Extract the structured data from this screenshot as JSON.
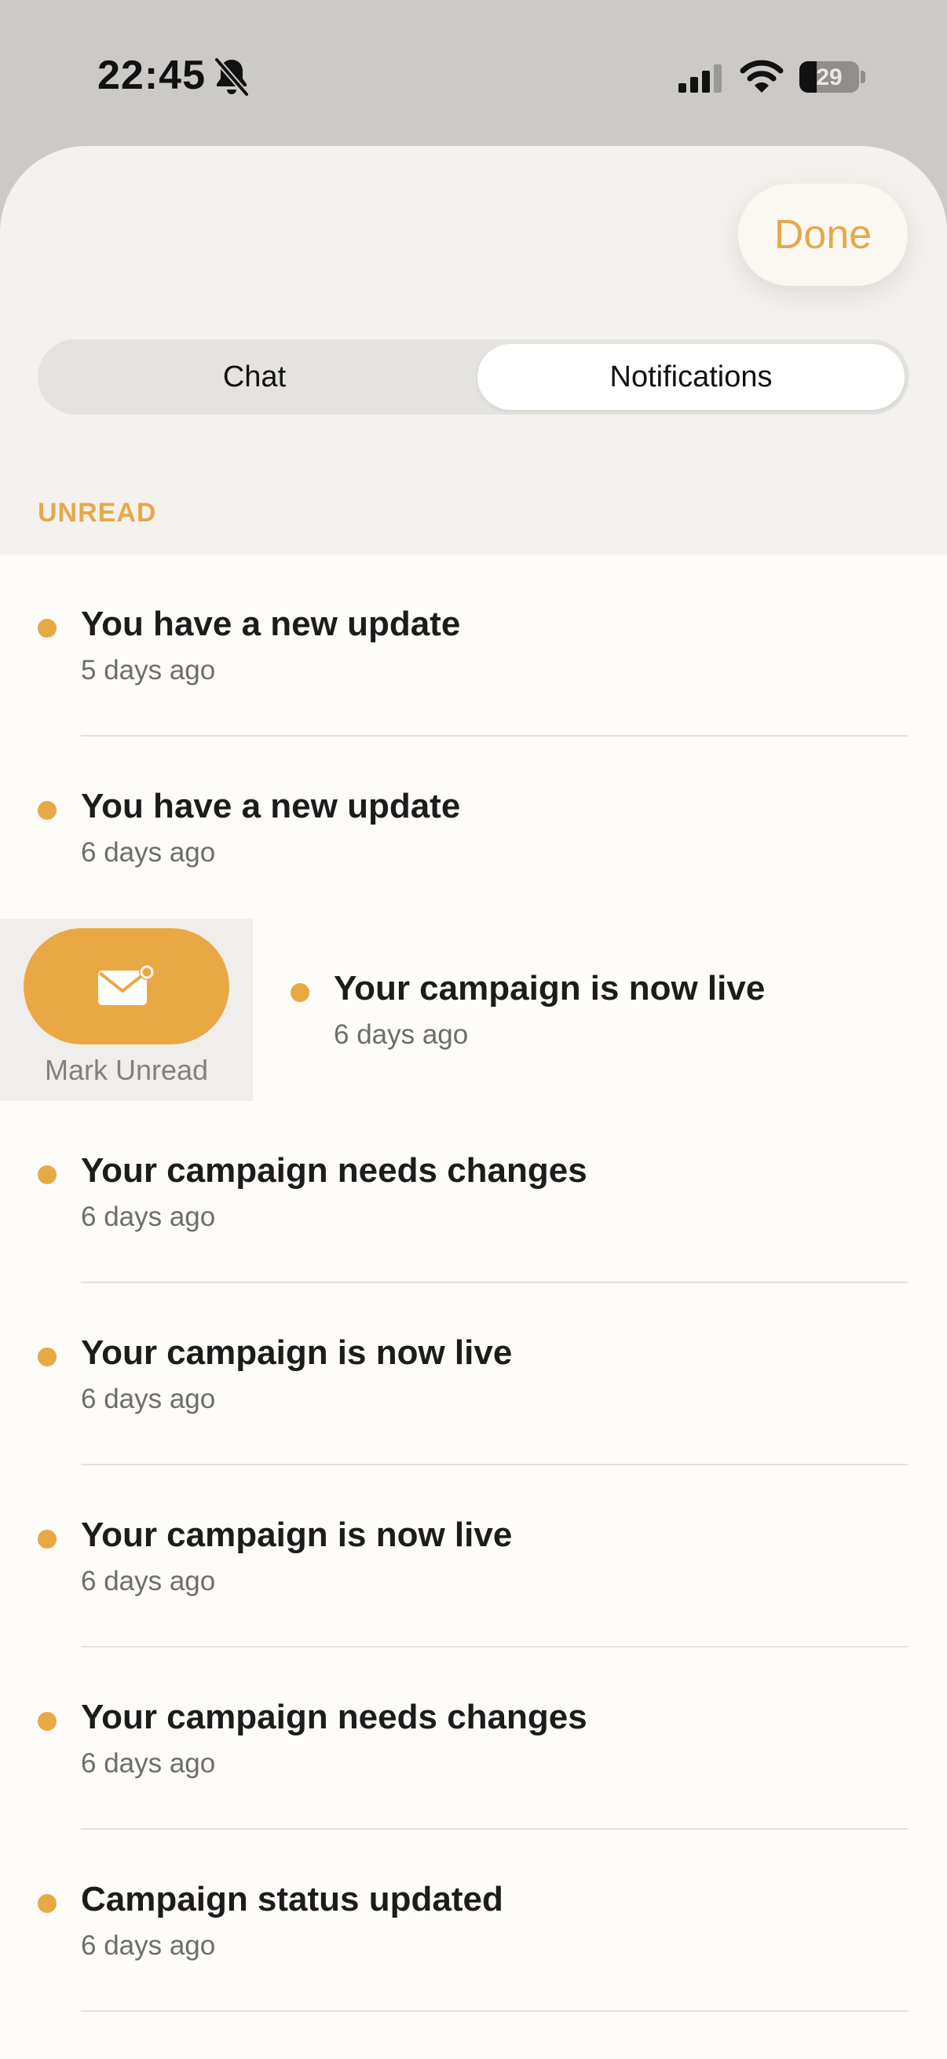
{
  "status_bar": {
    "time": "22:45",
    "battery_percent": "29",
    "icons": [
      "bell-off-icon",
      "cellular-signal-icon",
      "wifi-icon",
      "battery-icon"
    ]
  },
  "header": {
    "done_label": "Done"
  },
  "segmented_control": {
    "tabs": [
      {
        "label": "Chat",
        "selected": false
      },
      {
        "label": "Notifications",
        "selected": true
      }
    ]
  },
  "section": {
    "header": "UNREAD"
  },
  "swipe_action": {
    "label": "Mark Unread",
    "icon": "envelope-badge-icon"
  },
  "notifications": [
    {
      "title": "You have a new update",
      "time": "5 days ago"
    },
    {
      "title": "You have a new update",
      "time": "6 days ago"
    },
    {
      "title": "Your campaign is now live",
      "time": "6 days ago"
    },
    {
      "title": "Your campaign needs changes",
      "time": "6 days ago"
    },
    {
      "title": "Your campaign is now live",
      "time": "6 days ago"
    },
    {
      "title": "Your campaign is now live",
      "time": "6 days ago"
    },
    {
      "title": "Your campaign needs changes",
      "time": "6 days ago"
    },
    {
      "title": "Campaign status updated",
      "time": "6 days ago"
    }
  ],
  "colors": {
    "accent": "#e5a94a",
    "status_bar_background": "#cbcac7",
    "sheet_background": "#f4f2ef",
    "list_background": "#fdfcf8",
    "unread_dot": "#e8a945"
  }
}
